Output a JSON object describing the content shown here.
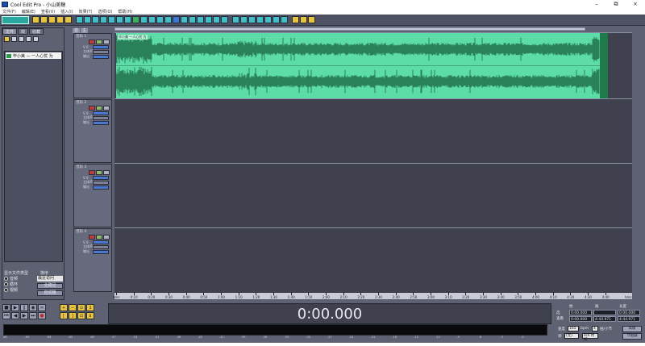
{
  "window": {
    "title": "Cool Edit Pro - 小山美糖",
    "minimize": "–",
    "maximize": "⧉",
    "close": "×"
  },
  "menu": [
    "文件(F)",
    "编辑(E)",
    "查看(V)",
    "插入(I)",
    "效果(T)",
    "选项(O)",
    "帮助(H)"
  ],
  "left_panel": {
    "tabs": [
      "文件",
      "效",
      "收藏"
    ],
    "file_item": "毕小美 — 一人心忧 为",
    "filter_label": "显示文件类型",
    "sort_label": "排序",
    "filters": [
      "音频",
      "循环",
      "视频"
    ],
    "sort_value": "最近访问",
    "btn_full_path": "全路径",
    "btn_auto_play": "自动播"
  },
  "multitrack": {
    "header_tabs": [
      "音",
      "主"
    ],
    "clip_label": "毕小美 一人心忧 为",
    "tracks": [
      {
        "name": "音轨 1",
        "number": "1",
        "vol": "V 0",
        "pan": "立体声",
        "out": "输出"
      },
      {
        "name": "音轨 2",
        "number": "2",
        "vol": "V 0",
        "pan": "立体声",
        "out": "输出"
      },
      {
        "name": "音轨 3",
        "number": "3",
        "vol": "V 0",
        "pan": "立体声",
        "out": "输出"
      },
      {
        "name": "音轨 4",
        "number": "4",
        "vol": "V 0",
        "pan": "立体声",
        "out": "输出"
      }
    ],
    "ruler_ticks": [
      "hms",
      "0:10",
      "0:20",
      "0:30",
      "0:40",
      "0:50",
      "1:00",
      "1:10",
      "1:20",
      "1:30",
      "1:40",
      "1:50",
      "2:00",
      "2:10",
      "2:20",
      "2:30",
      "2:40",
      "2:50",
      "3:00",
      "3:10",
      "3:20",
      "3:30",
      "3:40",
      "3:50",
      "4:00",
      "4:10",
      "4:20",
      "4:30",
      "4:40"
    ],
    "ruler_unit": "hms"
  },
  "transport": {
    "time": "0:00.000"
  },
  "selection": {
    "col_begin": "始",
    "col_end": "尾",
    "col_length": "长度",
    "row_sel": "选",
    "row_view": "查看",
    "sel_begin": "0:00.000",
    "sel_end": "",
    "sel_length": "0:00.000",
    "view_begin": "0:00.000",
    "view_end": "4:44.971",
    "view_length": "4:44.971"
  },
  "settings": {
    "tempo_label": "速度",
    "tempo": "165",
    "bpm_label": "bpm",
    "beats_value": "4",
    "beats_label": "拍/小节",
    "key_label": "调",
    "key_value": "(无)",
    "time_sig": "4/4 时间",
    "btn_advanced": "高级",
    "btn_metronome": "节拍器"
  },
  "level_scale": [
    "dB",
    "-69",
    "-66",
    "-63",
    "-60",
    "-57",
    "-54",
    "-51",
    "-48",
    "-45",
    "-42",
    "-39",
    "-36",
    "-33",
    "-30",
    "-27",
    "-24",
    "-21",
    "-18",
    "-15",
    "-12",
    "-9",
    "-6",
    "-3",
    "0"
  ],
  "colors": {
    "wave_bg": "#5cdda8",
    "wave_fg": "#1e6b44",
    "panel": "#5d6172",
    "lane": "#3f424e"
  }
}
